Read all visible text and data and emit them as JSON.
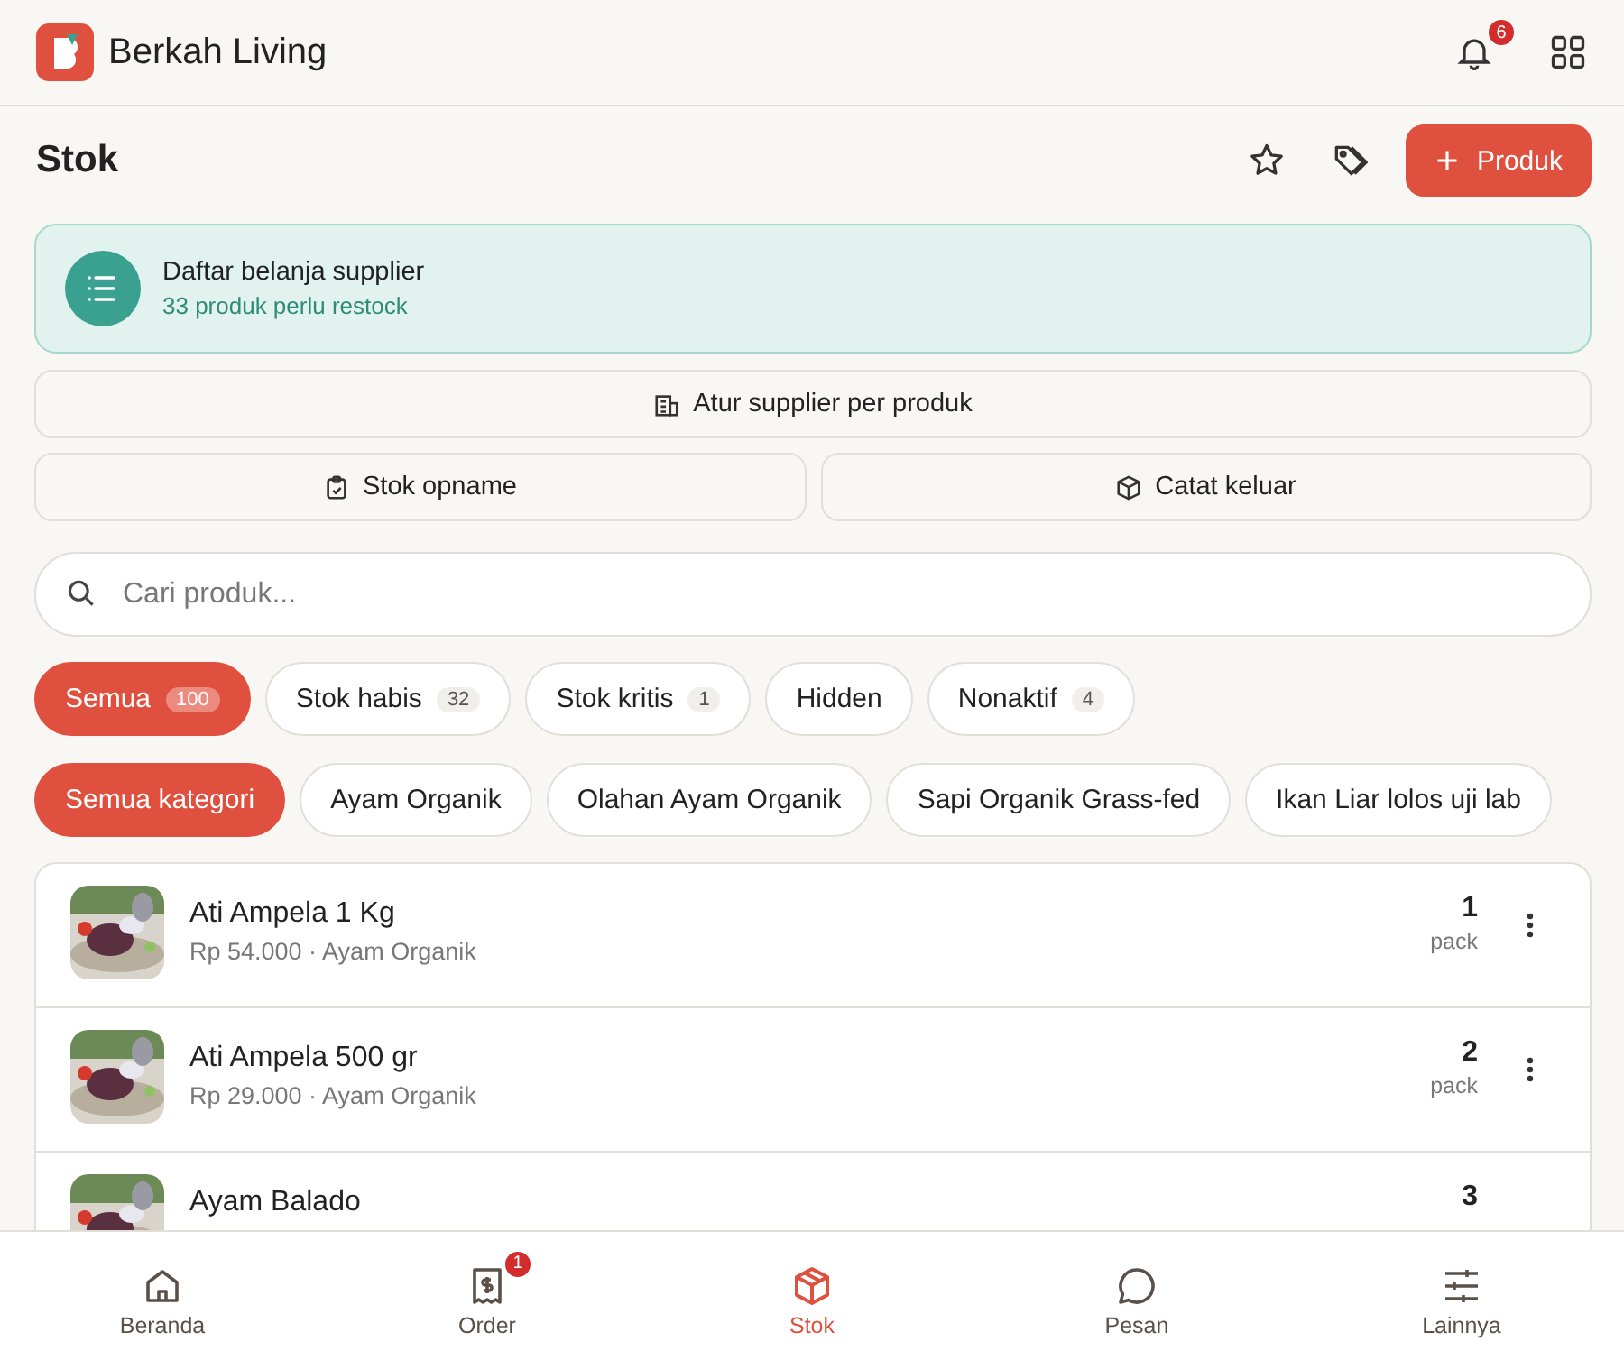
{
  "app": {
    "name": "Berkah Living",
    "notifications": "6"
  },
  "page": {
    "title": "Stok",
    "add_button": "Produk"
  },
  "banner": {
    "title": "Daftar belanja supplier",
    "subtitle": "33 produk perlu restock"
  },
  "actions": [
    {
      "label": "Atur supplier per produk",
      "kind": "building"
    },
    {
      "label": "Stok opname",
      "kind": "clipboard"
    },
    {
      "label": "Catat keluar",
      "kind": "box"
    }
  ],
  "search": {
    "placeholder": "Cari produk..."
  },
  "status_filters": [
    {
      "label": "Semua",
      "count": "100",
      "selected": true
    },
    {
      "label": "Stok habis",
      "count": "32",
      "selected": false
    },
    {
      "label": "Stok kritis",
      "count": "1",
      "selected": false
    },
    {
      "label": "Hidden",
      "selected": false
    },
    {
      "label": "Nonaktif",
      "count": "4",
      "selected": false
    }
  ],
  "category_filters": [
    {
      "label": "Semua kategori",
      "selected": true
    },
    {
      "label": "Ayam Organik",
      "selected": false
    },
    {
      "label": "Olahan Ayam Organik",
      "selected": false
    },
    {
      "label": "Sapi Organik Grass-fed",
      "selected": false
    },
    {
      "label": "Ikan Liar lolos uji lab",
      "selected": false
    }
  ],
  "products": [
    {
      "name": "Ati Ampela 1 Kg",
      "price": "Rp 54.000 · Ayam Organik",
      "qty": "1",
      "unit": "pack"
    },
    {
      "name": "Ati Ampela 500 gr",
      "price": "Rp 29.000 · Ayam Organik",
      "qty": "2",
      "unit": "pack"
    },
    {
      "name": "Ayam Balado",
      "qty": "3"
    }
  ],
  "bottom_nav": [
    {
      "label": "Beranda",
      "kind": "home",
      "selected": false
    },
    {
      "label": "Order",
      "kind": "receipt",
      "badge": "1",
      "selected": false
    },
    {
      "label": "Stok",
      "kind": "box",
      "selected": true
    },
    {
      "label": "Pesan",
      "kind": "chat",
      "selected": false
    },
    {
      "label": "Lainnya",
      "kind": "sliders",
      "selected": false
    }
  ]
}
